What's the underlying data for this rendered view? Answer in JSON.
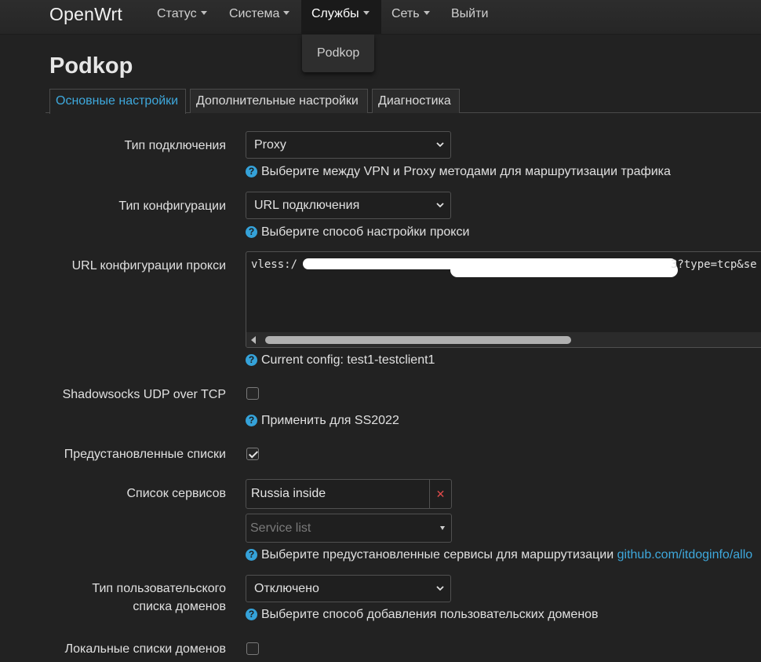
{
  "navbar": {
    "brand": "OpenWrt",
    "items": [
      {
        "label": "Статус",
        "dropdown": true
      },
      {
        "label": "Система",
        "dropdown": true
      },
      {
        "label": "Службы",
        "dropdown": true,
        "active": true
      },
      {
        "label": "Сеть",
        "dropdown": true
      },
      {
        "label": "Выйти",
        "dropdown": false
      }
    ],
    "open_menu": {
      "items": [
        "Podkop"
      ]
    }
  },
  "page": {
    "title": "Podkop"
  },
  "tabs": [
    "Основные настройки",
    "Дополнительные настройки",
    "Диагностика"
  ],
  "active_tab": "Основные настройки",
  "form": {
    "connection_type": {
      "label": "Тип подключения",
      "value": "Proxy",
      "help": "Выберите между VPN и Proxy методами для маршрутизации трафика"
    },
    "config_type": {
      "label": "Тип конфигурации",
      "value": "URL подключения",
      "help": "Выберите способ настройки прокси"
    },
    "proxy_url": {
      "label": "URL конфигурации прокси",
      "value_prefix": "vless:/",
      "value_suffix": "3?type=tcp&se",
      "help": "Current config: test1-testclient1"
    },
    "ss_udp_over_tcp": {
      "label": "Shadowsocks UDP over TCP",
      "checked": false,
      "help": "Применить для SS2022"
    },
    "preset_lists": {
      "label": "Предустановленные списки",
      "checked": true
    },
    "service_list": {
      "label": "Список сервисов",
      "selected": [
        "Russia inside"
      ],
      "remove_symbol": "✕",
      "placeholder": "Service list",
      "help": "Выберите предустановленные сервисы для маршрутизации",
      "help_link": "github.com/itdoginfo/allo"
    },
    "custom_domains_type": {
      "label_line1": "Тип пользовательского",
      "label_line2": "списка доменов",
      "value": "Отключено",
      "help": "Выберите способ добавления пользовательских доменов"
    },
    "local_domain_lists": {
      "label": "Локальные списки доменов",
      "checked": false
    }
  },
  "help_icon_glyph": "?",
  "colors": {
    "accent": "#3ea8dc",
    "background": "#222222",
    "remove": "#e04a4a"
  }
}
